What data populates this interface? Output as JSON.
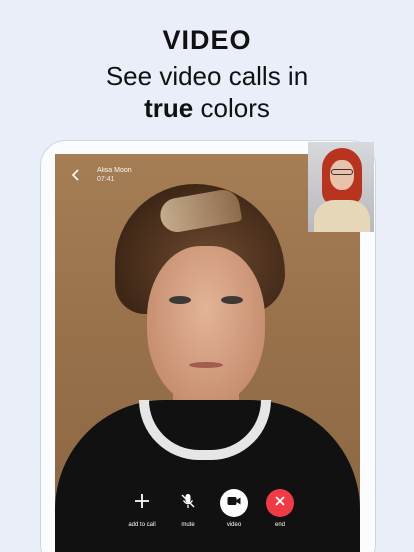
{
  "headline": {
    "kicker": "VIDEO",
    "line1": "See video calls in",
    "line2_bold": "true",
    "line2_rest": "colors"
  },
  "call": {
    "caller_name": "Alisa Moon",
    "duration": "07:41"
  },
  "controls": [
    {
      "label": "add to call",
      "icon": "plus-icon"
    },
    {
      "label": "mute",
      "icon": "mic-off-icon"
    },
    {
      "label": "video",
      "icon": "video-camera-icon"
    },
    {
      "label": "end",
      "icon": "close-icon"
    }
  ],
  "colors": {
    "background": "#e9eef9",
    "end_button": "#f03a45",
    "video_button": "#ffffff"
  }
}
